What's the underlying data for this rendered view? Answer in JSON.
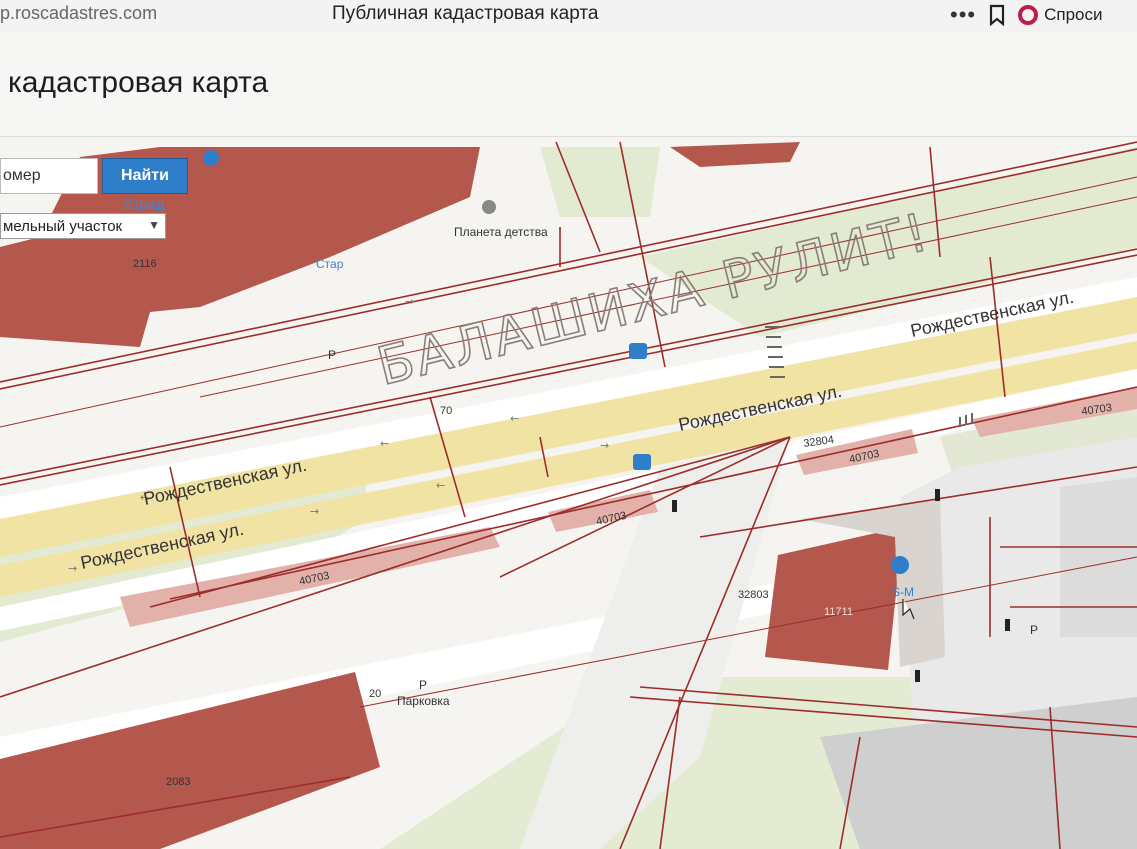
{
  "browser": {
    "url": "p.roscadastres.com",
    "tab_title": "Публичная кадастровая карта",
    "menu_icon": "more-dots-icon",
    "bookmark_icon": "bookmark-icon",
    "assistant_label": "Спроси"
  },
  "page": {
    "title": "кадастровая карта"
  },
  "search": {
    "placeholder": "омер",
    "button_label": "Найти",
    "type_selected": "мельный участок"
  },
  "map": {
    "watermark": "БАЛАШИХА РУЛИТ!",
    "colors": {
      "parcel": "#b4574c",
      "parcel_light": "#e2b1a9",
      "boundary": "#9c2d2a",
      "road": "#f1e3a4",
      "grass": "#e2ead2",
      "service_road": "#ffffff"
    },
    "street_labels": [
      "Рождественская ул.",
      "Рождественская ул.",
      "Рождественская ул.",
      "Рождественская ул."
    ],
    "parcel_labels": [
      "2116",
      "70",
      "40703",
      "40703",
      "40703",
      "40703",
      "32804",
      "32803",
      "11711",
      "20",
      "2083"
    ],
    "poi_labels": [
      "Юрид",
      "Стар",
      "Планета детства",
      "Парковка",
      "S-M"
    ],
    "parking_marks": [
      "P",
      "P",
      "P"
    ]
  }
}
